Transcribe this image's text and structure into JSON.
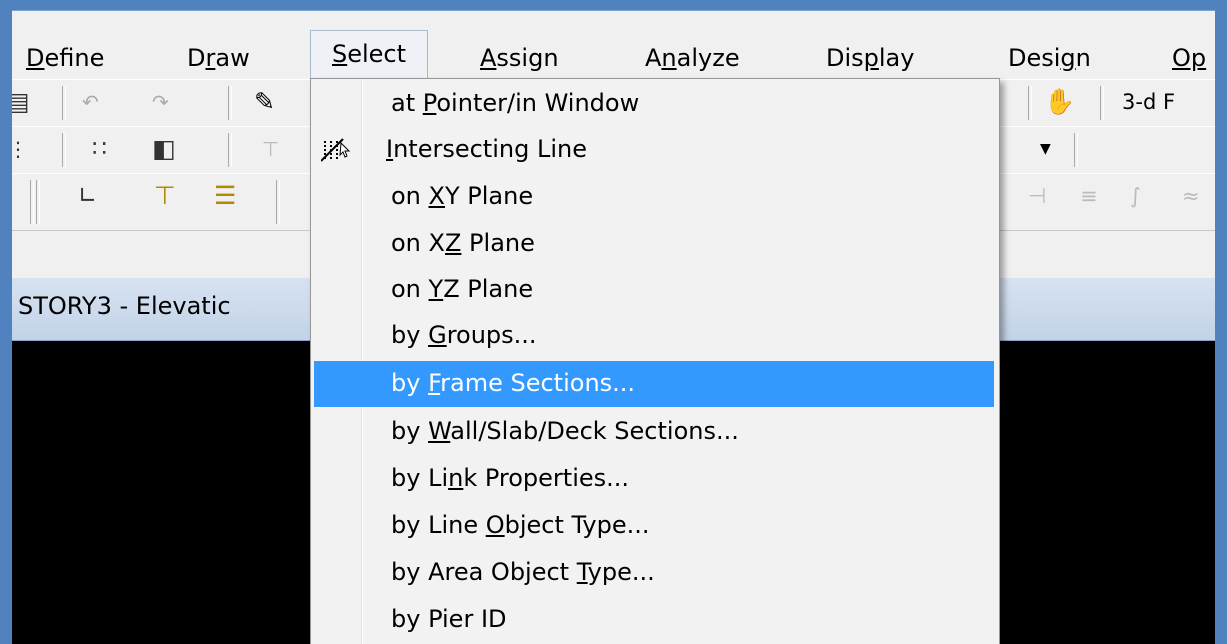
{
  "menubar": {
    "items": [
      {
        "pre": "",
        "acc": "D",
        "post": "efine"
      },
      {
        "pre": "D",
        "acc": "r",
        "post": "aw"
      },
      {
        "pre": "",
        "acc": "S",
        "post": "elect"
      },
      {
        "pre": "",
        "acc": "A",
        "post": "ssign"
      },
      {
        "pre": "A",
        "acc": "n",
        "post": "alyze"
      },
      {
        "pre": "Dis",
        "acc": "p",
        "post": "lay"
      },
      {
        "pre": "Desi",
        "acc": "g",
        "post": "n"
      },
      {
        "pre": "",
        "acc": "Op",
        "post": ""
      }
    ]
  },
  "toolbar": {
    "row1_right_label": "3-d F"
  },
  "window": {
    "title": "STORY3 - Elevatic"
  },
  "select_menu": {
    "items": [
      {
        "pre": "at ",
        "acc": "P",
        "post": "ointer/in Window"
      },
      {
        "pre": "",
        "acc": "I",
        "post": "ntersecting Line",
        "icon": "intersecting-line-icon"
      },
      {
        "pre": "on ",
        "acc": "X",
        "post": "Y Plane"
      },
      {
        "pre": "on X",
        "acc": "Z",
        "post": " Plane"
      },
      {
        "pre": "on ",
        "acc": "Y",
        "post": "Z Plane"
      },
      {
        "pre": "by ",
        "acc": "G",
        "post": "roups..."
      },
      {
        "pre": "by ",
        "acc": "F",
        "post": "rame Sections...",
        "highlighted": true
      },
      {
        "pre": "by ",
        "acc": "W",
        "post": "all/Slab/Deck Sections..."
      },
      {
        "pre": "by Li",
        "acc": "n",
        "post": "k Properties..."
      },
      {
        "pre": "by Line ",
        "acc": "O",
        "post": "bject Type..."
      },
      {
        "pre": "by Area Object ",
        "acc": "T",
        "post": "ype..."
      },
      {
        "pre": "by Pier ID",
        "acc": "",
        "post": ""
      }
    ]
  },
  "colors": {
    "highlight": "#3399ff",
    "menu_background": "#f2f2f2",
    "outer_border": "#4f82be"
  }
}
